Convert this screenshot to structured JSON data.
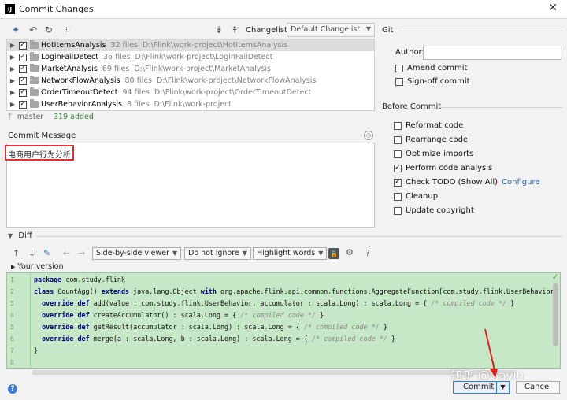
{
  "window": {
    "title": "Commit Changes",
    "close_glyph": "✕"
  },
  "toolbar": {
    "changelist_label": "Changelist:",
    "changelist_value": "Default Changelist"
  },
  "tree": {
    "rows": [
      {
        "name": "HotItemsAnalysis",
        "count": "32 files",
        "path": "D:\\Flink\\work-project\\HotItemsAnalysis"
      },
      {
        "name": "LoginFailDetect",
        "count": "36 files",
        "path": "D:\\Flink\\work-project\\LoginFailDetect"
      },
      {
        "name": "MarketAnalysis",
        "count": "69 files",
        "path": "D:\\Flink\\work-project\\MarketAnalysis"
      },
      {
        "name": "NetworkFlowAnalysis",
        "count": "80 files",
        "path": "D:\\Flink\\work-project\\NetworkFlowAnalysis"
      },
      {
        "name": "OrderTimeoutDetect",
        "count": "94 files",
        "path": "D:\\Flink\\work-project\\OrderTimeoutDetect"
      },
      {
        "name": "UserBehaviorAnalysis",
        "count": "8 files",
        "path": "D:\\Flink\\work-project"
      }
    ]
  },
  "status": {
    "branch": "master",
    "added": "319 added"
  },
  "commit_message": {
    "label": "Commit Message",
    "value": "电商用户行为分析"
  },
  "git": {
    "heading": "Git",
    "author_label": "Author:",
    "author_value": "",
    "amend": "Amend commit",
    "signoff": "Sign-off commit"
  },
  "before_commit": {
    "heading": "Before Commit",
    "items": [
      {
        "label": "Reformat code",
        "checked": false
      },
      {
        "label": "Rearrange code",
        "checked": false
      },
      {
        "label": "Optimize imports",
        "checked": false
      },
      {
        "label": "Perform code analysis",
        "checked": true
      },
      {
        "label": "Check TODO (Show All)",
        "checked": true
      },
      {
        "label": "Cleanup",
        "checked": false
      },
      {
        "label": "Update copyright",
        "checked": false
      }
    ],
    "configure_link": "Configure"
  },
  "diff": {
    "label": "Diff",
    "viewer": "Side-by-side viewer",
    "ignore": "Do not ignore",
    "highlight": "Highlight words",
    "version_label": "Your version",
    "line_numbers": [
      "1",
      "2",
      "3",
      "4",
      "5",
      "6",
      "7",
      "8"
    ]
  },
  "buttons": {
    "commit": "Commit",
    "cancel": "Cancel",
    "help": "?"
  },
  "watermark": "知乎 @Gavin",
  "colors": {
    "accent": "#3b78d6",
    "diff_bg": "#c6e8c6",
    "highlight_border": "#dd3333",
    "added": "#3a8a3a"
  }
}
